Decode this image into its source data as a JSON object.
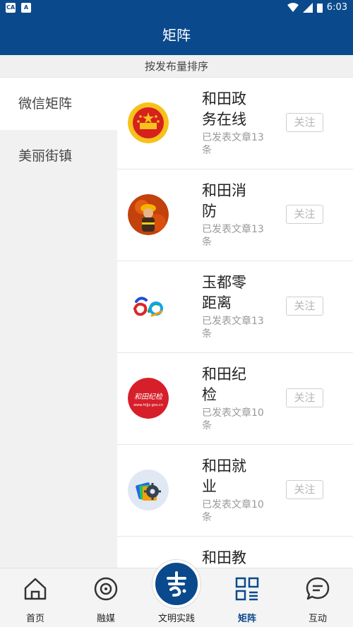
{
  "status_bar": {
    "time": "6:03"
  },
  "header": {
    "title": "矩阵"
  },
  "sort": {
    "label": "按发布量排序"
  },
  "sidebar": {
    "items": [
      {
        "label": "微信矩阵",
        "active": true
      },
      {
        "label": "美丽街镇",
        "active": false
      }
    ]
  },
  "accounts": [
    {
      "name_line1": "和田政",
      "name_line2": "务在线",
      "count_line1": "已发表文章13",
      "count_line2": "条",
      "follow": "关注",
      "icon": "national-emblem-icon"
    },
    {
      "name_line1": "和田消",
      "name_line2": "防",
      "count_line1": "已发表文章13",
      "count_line2": "条",
      "follow": "关注",
      "icon": "firefighter-icon"
    },
    {
      "name_line1": "玉都零",
      "name_line2": "距离",
      "count_line1": "已发表文章13",
      "count_line2": "条",
      "follow": "关注",
      "icon": "anniversary-60-logo"
    },
    {
      "name_line1": "和田纪",
      "name_line2": "检",
      "count_line1": "已发表文章10",
      "count_line2": "条",
      "follow": "关注",
      "icon": "discipline-inspection-logo",
      "logo_text": "和田纪检",
      "logo_url": "www.htjjz.gov.cn"
    },
    {
      "name_line1": "和田就",
      "name_line2": "业",
      "count_line1": "已发表文章10",
      "count_line2": "条",
      "follow": "关注",
      "icon": "gear-folders-icon"
    },
    {
      "name_line1": "和田教",
      "name_line2": "",
      "count_line1": "",
      "count_line2": "",
      "follow": "",
      "icon": ""
    }
  ],
  "bottom_nav": {
    "items": [
      {
        "label": "首页",
        "icon": "home-icon"
      },
      {
        "label": "融媒",
        "icon": "media-icon"
      },
      {
        "label": "文明实践",
        "icon": "zhi-logo-icon"
      },
      {
        "label": "矩阵",
        "icon": "matrix-grid-icon",
        "active": true
      },
      {
        "label": "互动",
        "icon": "chat-bubble-icon"
      }
    ]
  },
  "colors": {
    "primary": "#0a4a8c",
    "sidebar_bg": "#f1f1f1",
    "muted": "#999999"
  }
}
